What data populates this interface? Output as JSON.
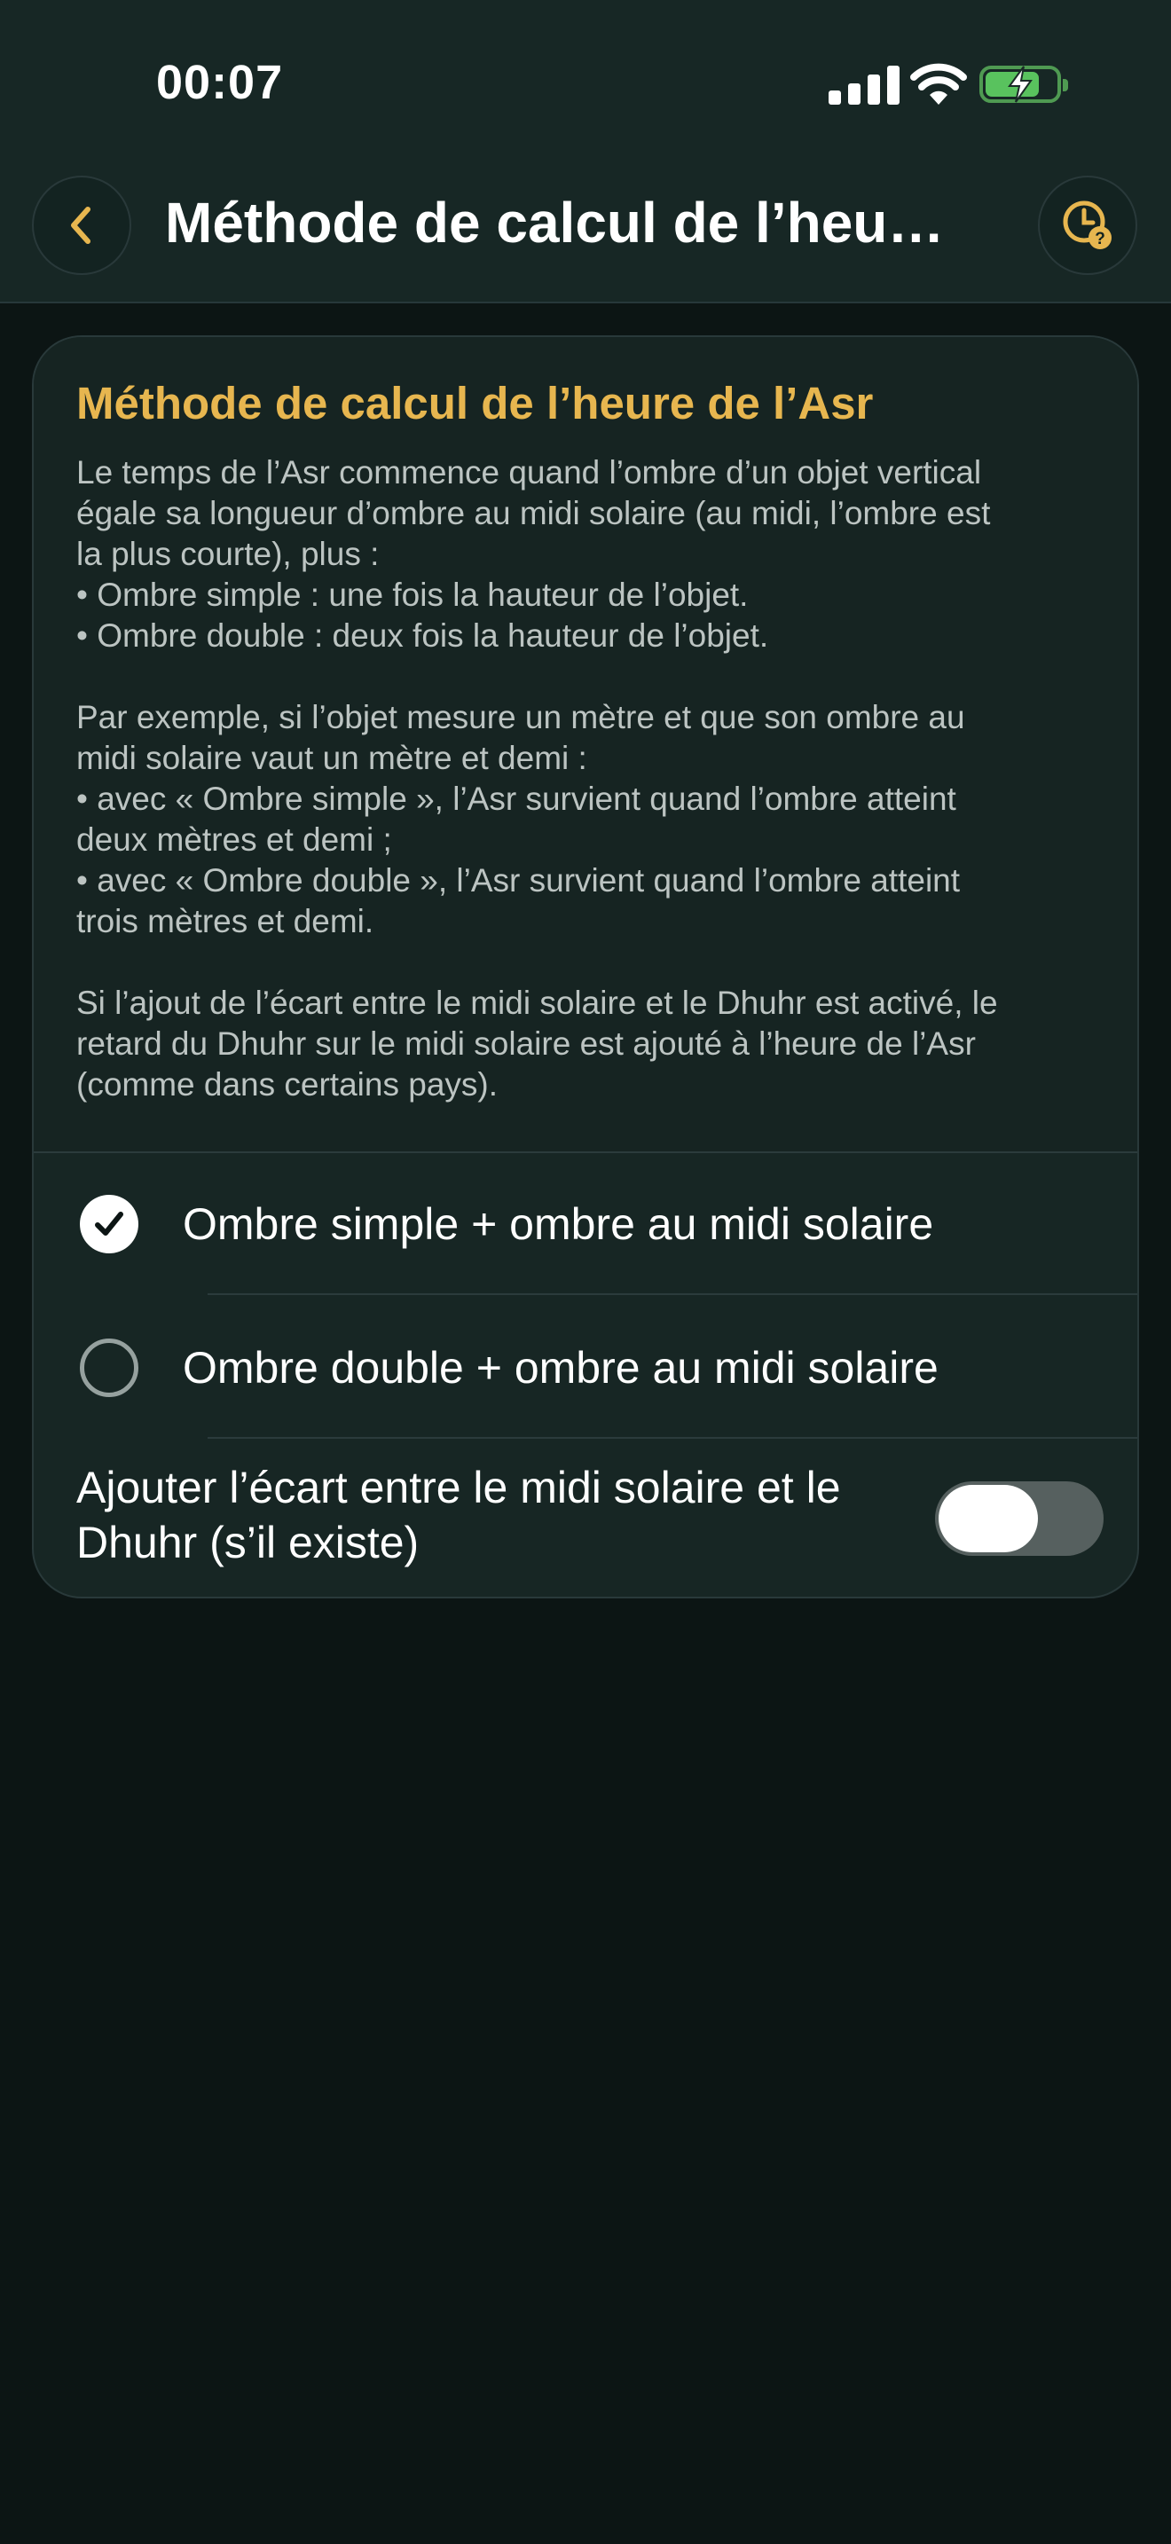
{
  "status_bar": {
    "time": "00:07"
  },
  "header": {
    "title": "Méthode de calcul de l’heu…",
    "back_icon": "chevron-left-icon",
    "help_icon": "clock-question-icon",
    "accent_color": "#e7b64f"
  },
  "card": {
    "title": "Méthode de calcul de l’heure de l’Asr",
    "description": "Le temps de l’Asr commence quand l’ombre d’un objet vertical\négale sa longueur d’ombre au midi solaire (au midi, l’ombre est\nla plus courte), plus :\n• Ombre simple : une fois la hauteur de l’objet.\n• Ombre double : deux fois la hauteur de l’objet.\n\nPar exemple, si l’objet mesure un mètre et que son ombre au\nmidi solaire vaut un mètre et demi :\n• avec « Ombre simple », l’Asr survient quand l’ombre atteint\ndeux mètres et demi ;\n• avec « Ombre double », l’Asr survient quand l’ombre atteint\ntrois mètres et demi.\n\nSi l’ajout de l’écart entre le midi solaire et le Dhuhr est activé, le\nretard du Dhuhr sur le midi solaire est ajouté à l’heure de l’Asr\n(comme dans certains pays).",
    "options": [
      {
        "label": "Ombre simple + ombre au midi solaire",
        "selected": true
      },
      {
        "label": "Ombre double + ombre au midi solaire",
        "selected": false
      }
    ],
    "toggle": {
      "label": "Ajouter l’écart entre le midi solaire et le Dhuhr (s’il existe)",
      "on": false
    }
  }
}
